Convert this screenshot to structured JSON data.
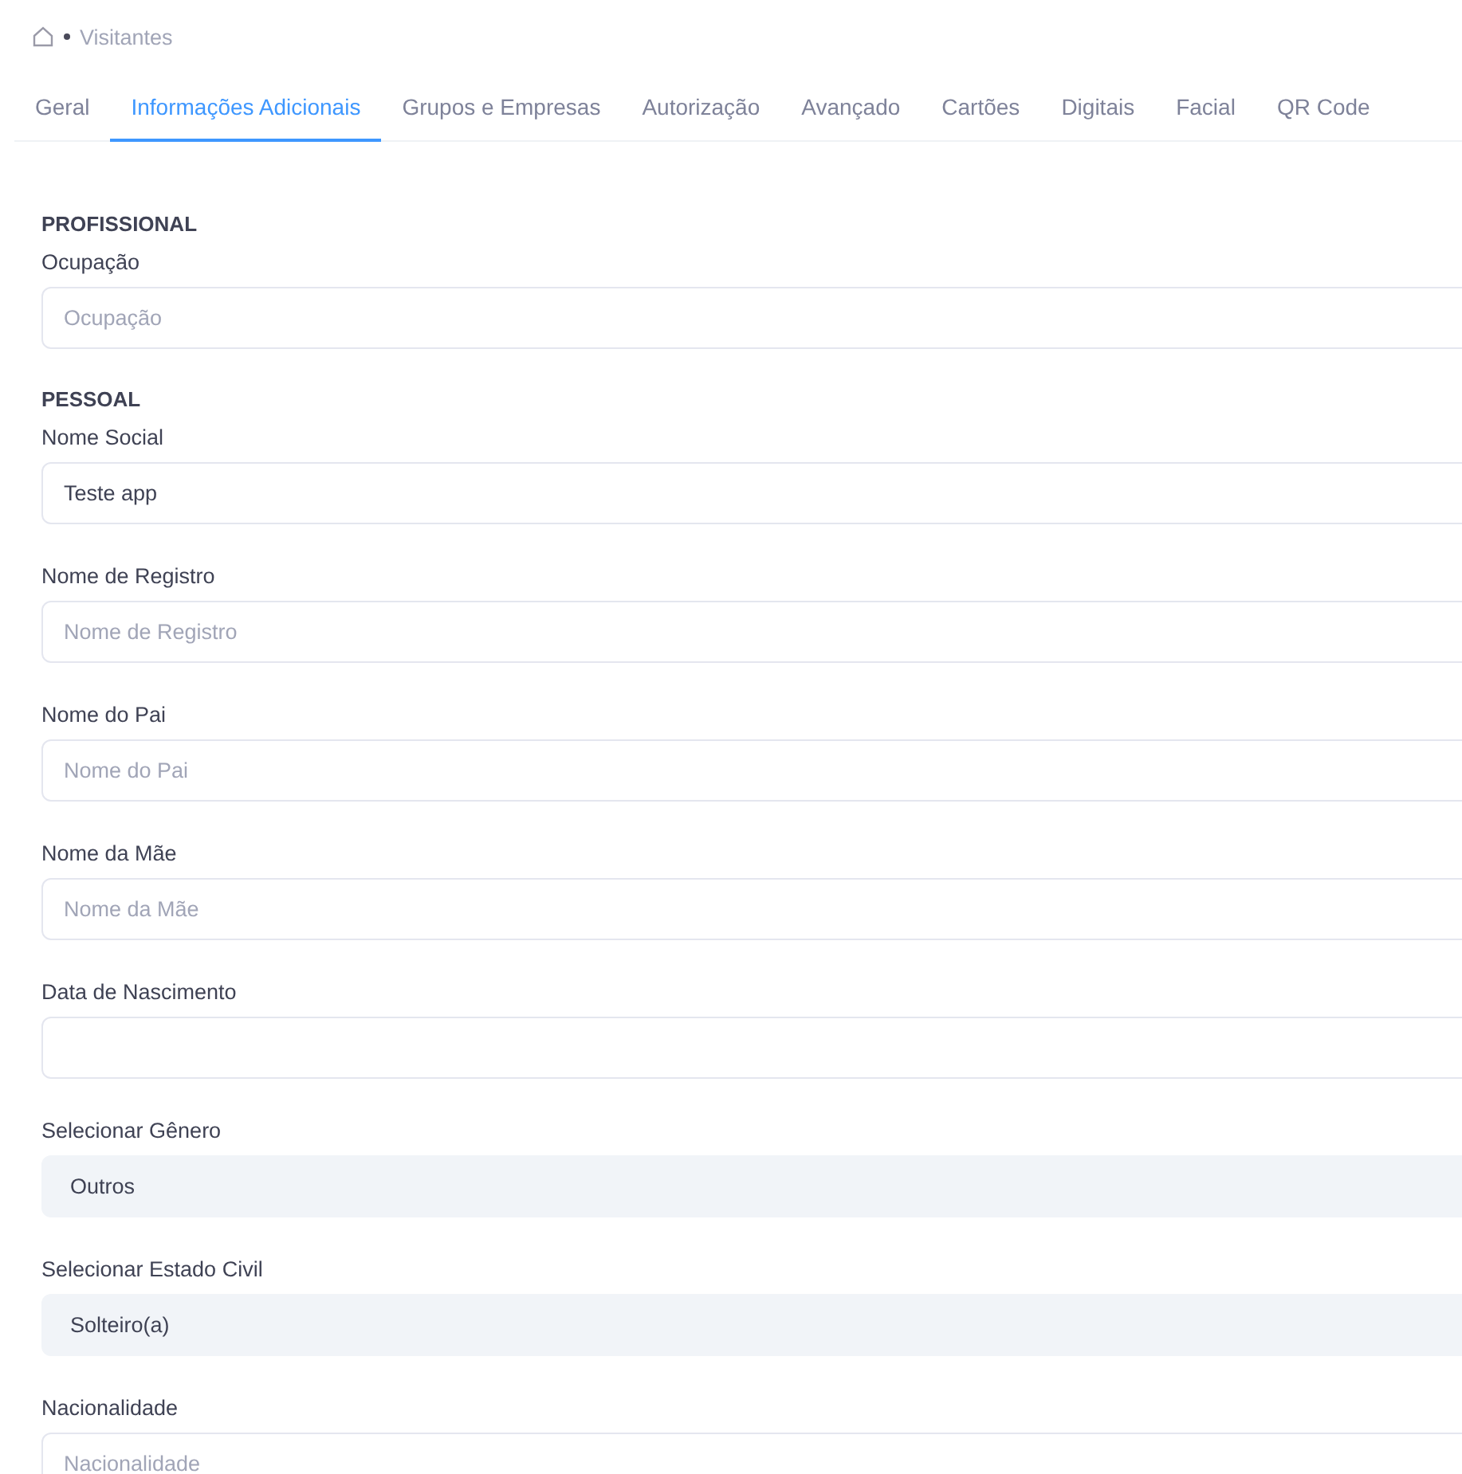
{
  "breadcrumb": {
    "current": "Visitantes"
  },
  "tabs": [
    {
      "label": "Geral",
      "selected": false
    },
    {
      "label": "Informações Adicionais",
      "selected": true
    },
    {
      "label": "Grupos e Empresas",
      "selected": false
    },
    {
      "label": "Autorização",
      "selected": false
    },
    {
      "label": "Avançado",
      "selected": false
    },
    {
      "label": "Cartões",
      "selected": false
    },
    {
      "label": "Digitais",
      "selected": false
    },
    {
      "label": "Facial",
      "selected": false
    },
    {
      "label": "QR Code",
      "selected": false
    }
  ],
  "sections": [
    {
      "title": "PROFISSIONAL",
      "fields": [
        {
          "kind": "input",
          "label": "Ocupação",
          "placeholder": "Ocupação"
        }
      ]
    },
    {
      "title": "PESSOAL",
      "fields": [
        {
          "kind": "input",
          "label": "Nome Social",
          "value": "Teste app"
        },
        {
          "kind": "input",
          "label": "Nome de Registro",
          "placeholder": "Nome de Registro"
        },
        {
          "kind": "input",
          "label": "Nome do Pai",
          "placeholder": "Nome do Pai"
        },
        {
          "kind": "input",
          "label": "Nome da Mãe",
          "placeholder": "Nome da Mãe"
        },
        {
          "kind": "input",
          "label": "Data de Nascimento"
        },
        {
          "kind": "select",
          "label": "Selecionar Gênero",
          "value": "Outros"
        },
        {
          "kind": "select",
          "label": "Selecionar Estado Civil",
          "value": "Solteiro(a)"
        },
        {
          "kind": "input",
          "label": "Nacionalidade",
          "placeholder": "Nacionalidade"
        }
      ]
    }
  ]
}
